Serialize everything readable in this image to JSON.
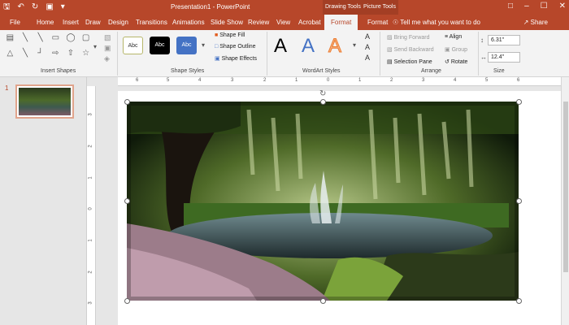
{
  "titlebar": {
    "title": "Presentation1 - PowerPoint",
    "drawing_tools": "Drawing Tools",
    "picture_tools": "Picture Tools"
  },
  "tabs": [
    "File",
    "Home",
    "Insert",
    "Draw",
    "Design",
    "Transitions",
    "Animations",
    "Slide Show",
    "Review",
    "View",
    "Acrobat",
    "Format",
    "Format"
  ],
  "tell": "Tell me what you want to do",
  "share": "Share",
  "ribbon": {
    "groups": {
      "insert_shapes": "Insert Shapes",
      "shape_styles": "Shape Styles",
      "wordart_styles": "WordArt Styles",
      "arrange": "Arrange",
      "size": "Size"
    },
    "abc": "Abc",
    "shape_fill": "Shape Fill",
    "shape_outline": "Shape Outline",
    "shape_effects": "Shape Effects",
    "wordart_letter": "A",
    "bring_forward": "Bring Forward",
    "send_backward": "Send Backward",
    "selection_pane": "Selection Pane",
    "align": "Align",
    "group": "Group",
    "rotate": "Rotate",
    "height": "6.31\"",
    "width": "12.4\""
  },
  "slides": {
    "number": "1"
  },
  "ruler_h": [
    "6",
    "5",
    "4",
    "3",
    "2",
    "1",
    "0",
    "1",
    "2",
    "3",
    "4",
    "5",
    "6"
  ],
  "ruler_v": [
    "3",
    "2",
    "1",
    "0",
    "1",
    "2",
    "3"
  ],
  "colors": {
    "accent": "#b7472a"
  }
}
